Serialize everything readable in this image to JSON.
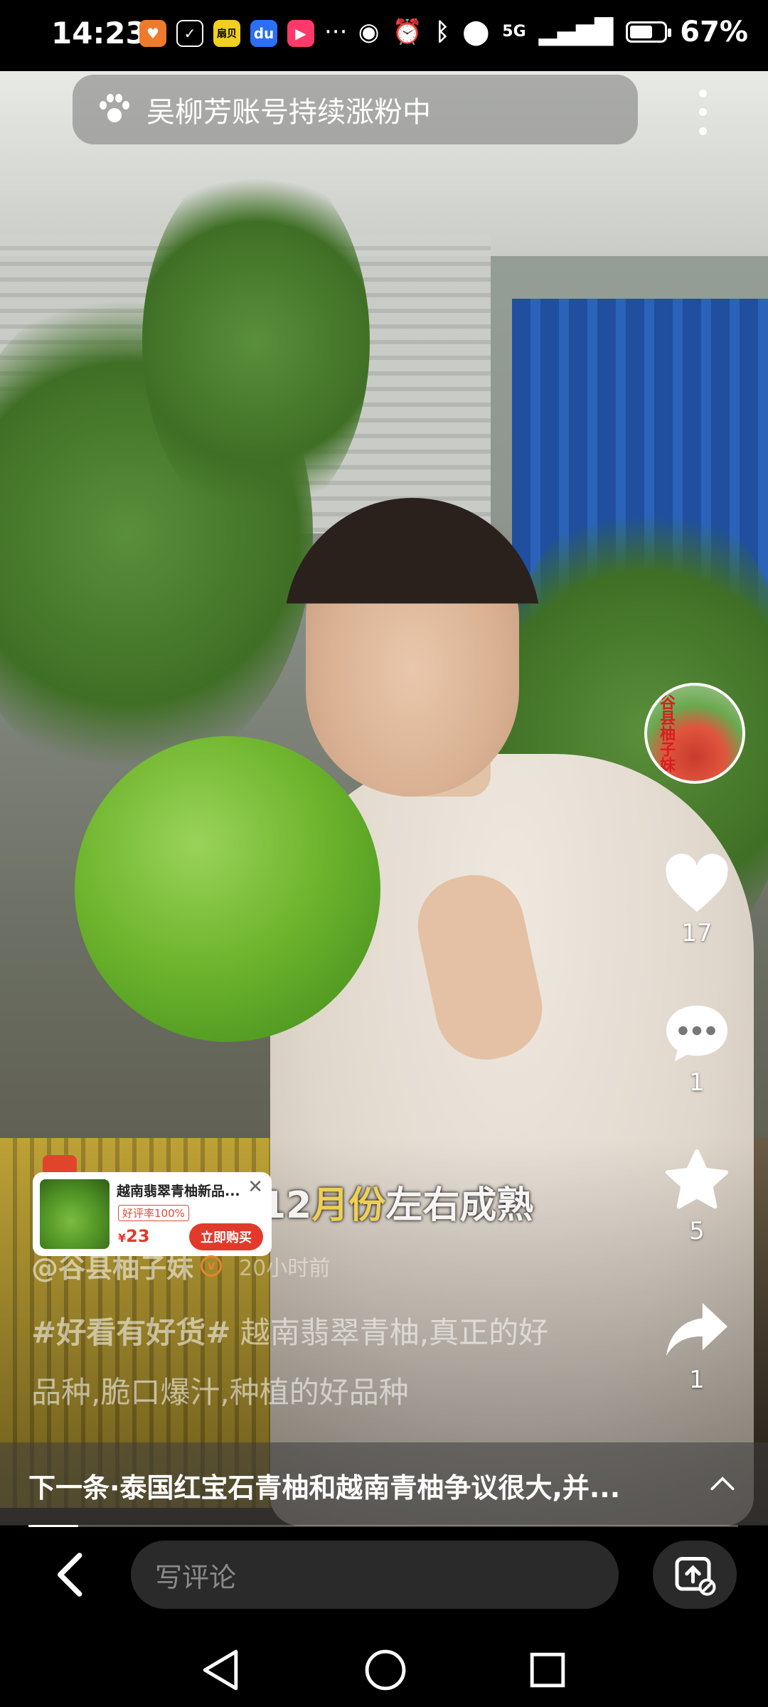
{
  "status_bar": {
    "time": "14:23",
    "notifications": [
      {
        "name": "taobao-app-icon",
        "label": "",
        "color": "#f07a2c"
      },
      {
        "name": "app-icon-2",
        "label": "",
        "color": "#000000"
      },
      {
        "name": "app-icon-yellow",
        "label": "扇贝",
        "color": "#f2cf20"
      },
      {
        "name": "baidu-app-icon",
        "label": "",
        "color": "#2b6ff5"
      },
      {
        "name": "video-app-icon",
        "label": "",
        "color": "#ff3a6a"
      }
    ],
    "more_dots": "···",
    "network": "5G",
    "battery_level": 0.67,
    "battery": "67%"
  },
  "top_bar": {
    "search_text": "吴柳芳账号持续涨粉中"
  },
  "rail": {
    "avatar_text": "谷县柚子妹",
    "likes": "17",
    "comments": "1",
    "favorites": "5",
    "shares": "1"
  },
  "product": {
    "name": "越南翡翠青柚新品...",
    "rating": "好评率100%",
    "price_symbol": "¥",
    "price": "23",
    "buy_label": "立即购买"
  },
  "subtitle": {
    "part1": "12",
    "highlight": "月份",
    "part2": "左右成熟"
  },
  "post": {
    "author": "@谷县柚子妹",
    "verified": "v",
    "time": "20小时前",
    "hashtag": "#好看有好货#",
    "description": " 越南翡翠青柚,真正的好品种,脆口爆汁,种植的好品种"
  },
  "next": {
    "text": "下一条·泰国红宝石青柚和越南青柚争议很大,并..."
  },
  "progress": 0.07,
  "comment_bar": {
    "placeholder": "写评论"
  }
}
